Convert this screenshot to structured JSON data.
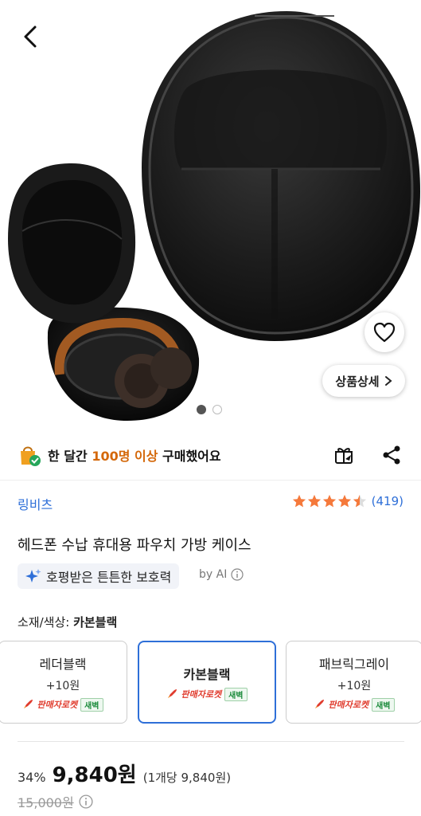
{
  "gallery": {
    "detail_label": "상품상세",
    "page_count": 2,
    "current_page": 1
  },
  "purchase_stat": {
    "prefix": "한 달간 ",
    "highlight": "100명 이상",
    "suffix": " 구매했어요"
  },
  "product": {
    "brand": "링비츠",
    "rating_value": 4.5,
    "review_count": "(419)",
    "title": "헤드폰 수납 휴대용 파우치 가방 케이스",
    "ai_summary": "호평받은 튼튼한 보호력",
    "ai_label": "by AI"
  },
  "options": {
    "label_prefix": "소재/색상: ",
    "selected": "카본블랙",
    "items": [
      {
        "name": "레더블랙",
        "extra": "+10원",
        "rocket": "판매자로켓",
        "dawn": "새벽"
      },
      {
        "name": "카본블랙",
        "extra": "",
        "rocket": "판매자로켓",
        "dawn": "새벽"
      },
      {
        "name": "패브릭그레이",
        "extra": "+10원",
        "rocket": "판매자로켓",
        "dawn": "새벽"
      }
    ]
  },
  "price": {
    "discount": "34%",
    "sale": "9,840원",
    "unit": "(1개당 9,840원)",
    "original": "15,000원"
  },
  "colors": {
    "accent": "#2e6fd8",
    "highlight": "#d4680a",
    "star": "#f5793b",
    "rocket": "#e03c2e"
  }
}
